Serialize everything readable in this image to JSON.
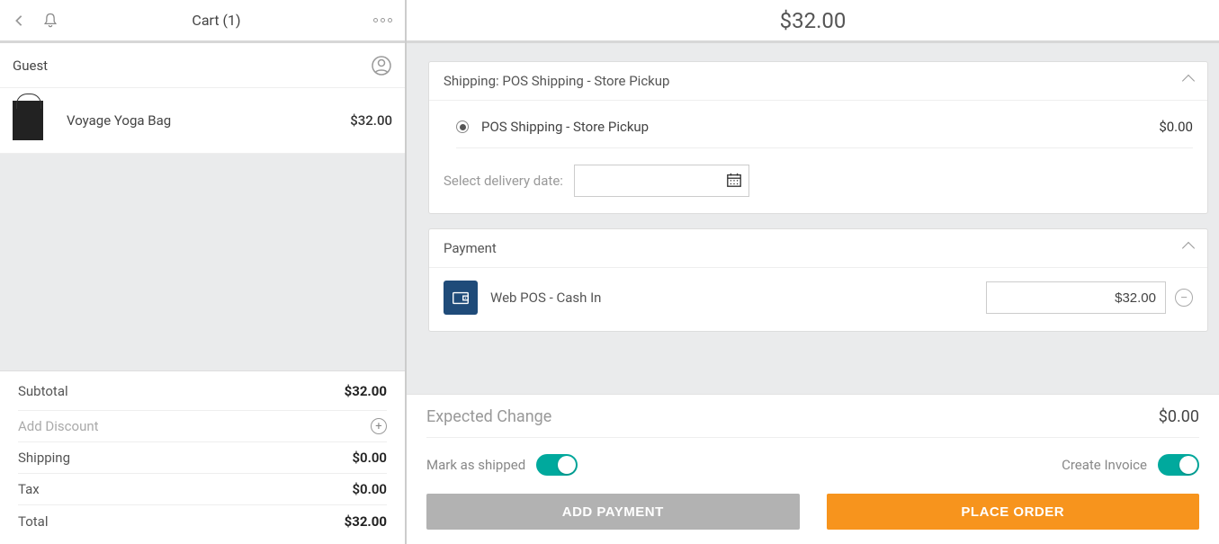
{
  "header": {
    "cart_title": "Cart (1)",
    "grand_total": "$32.00"
  },
  "guest": {
    "label": "Guest"
  },
  "cart": {
    "items": [
      {
        "name": "Voyage Yoga Bag",
        "price": "$32.00"
      }
    ]
  },
  "totals": {
    "subtotal_label": "Subtotal",
    "subtotal_value": "$32.00",
    "discount_label": "Add Discount",
    "shipping_label": "Shipping",
    "shipping_value": "$0.00",
    "tax_label": "Tax",
    "tax_value": "$0.00",
    "total_label": "Total",
    "total_value": "$32.00"
  },
  "shipping": {
    "header": "Shipping: POS Shipping - Store Pickup",
    "option_name": "POS Shipping - Store Pickup",
    "option_price": "$0.00",
    "delivery_label": "Select delivery date:",
    "delivery_value": ""
  },
  "payment": {
    "header": "Payment",
    "method_name": "Web POS - Cash In",
    "amount": "$32.00"
  },
  "footer": {
    "expected_label": "Expected Change",
    "expected_value": "$0.00",
    "mark_shipped_label": "Mark as shipped",
    "create_invoice_label": "Create Invoice",
    "add_payment_btn": "ADD PAYMENT",
    "place_order_btn": "PLACE ORDER"
  }
}
